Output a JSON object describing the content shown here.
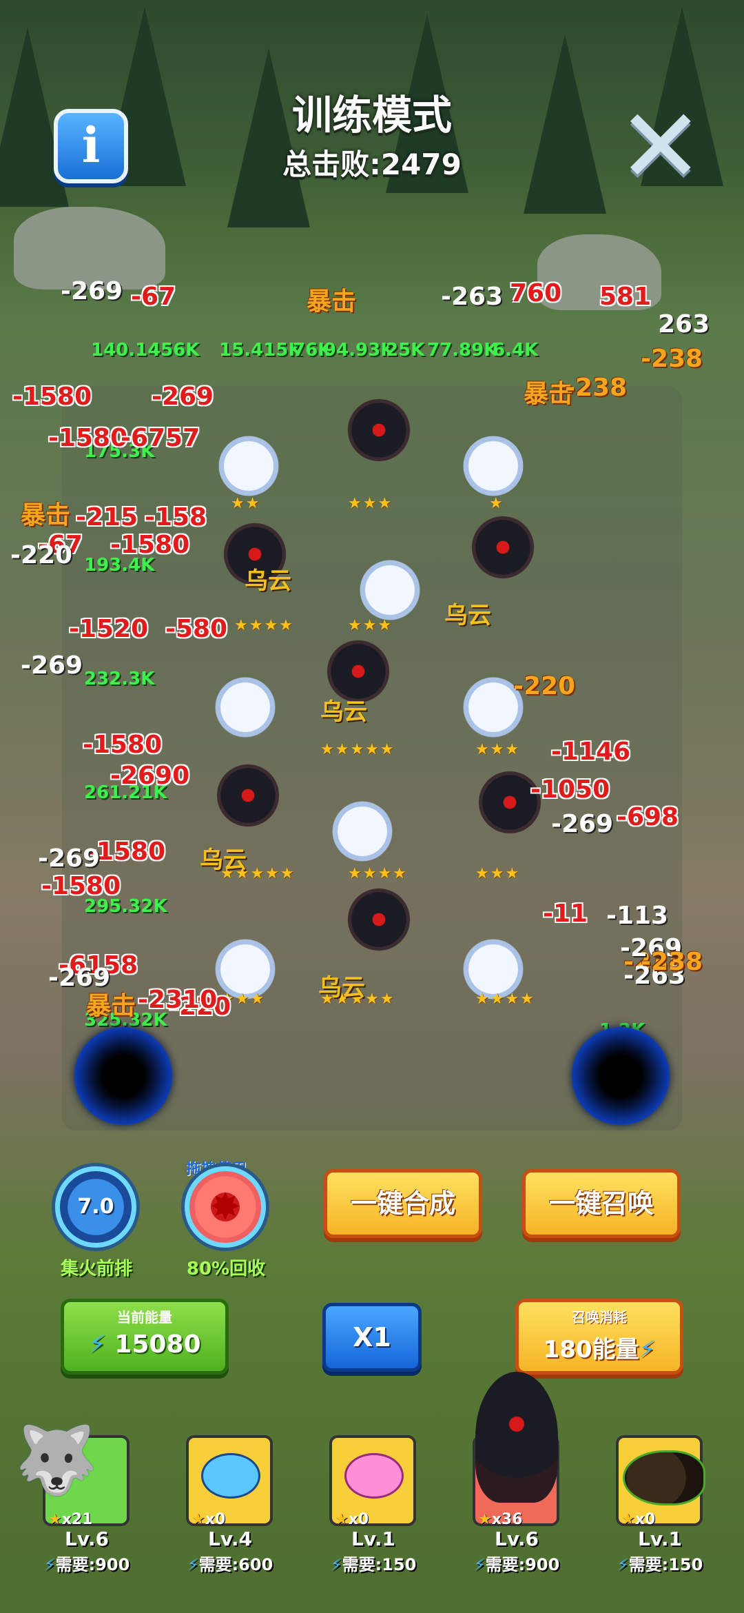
{
  "header": {
    "title": "训练模式",
    "subtitle": "总击败:2479",
    "info_icon": "info-icon",
    "close_icon": "close-icon"
  },
  "battle": {
    "unit_tags": [
      "乌云",
      "乌云",
      "乌云",
      "乌云",
      "乌云"
    ],
    "star_rows": [
      "★★",
      "★★★",
      "★",
      "★★★★",
      "★★★",
      "★★★★★",
      "★★★",
      "★★★★★",
      "★★★★",
      "★★★",
      "★★★",
      "★★★★★",
      "★★★★"
    ],
    "floating_numbers": [
      "-269",
      "-67",
      "暴击",
      "-263",
      "760",
      "581",
      "-238",
      "263",
      "-1580",
      "-269",
      "-1580",
      "-6757",
      "暴击",
      "-215",
      "-158",
      "-67",
      "-1580",
      "-220",
      "-1520",
      "-580",
      "-269",
      "-2690",
      "-1580",
      "暴击",
      "-238",
      "-1146",
      "-698",
      "-1580",
      "-1580",
      "-269",
      "-6158",
      "-220",
      "-269",
      "-1050",
      "-220",
      "-269",
      "暴击",
      "-2310",
      "-11",
      "-238",
      "-269",
      "-263",
      "-113",
      "-238"
    ],
    "hp_labels": [
      "140.14",
      "456K",
      "15.415K",
      "76K",
      "94.93K",
      "25K",
      "77.89K",
      "6.4K",
      "175.3K",
      "193.4K",
      "232.3K",
      "261.21K",
      "295.32K",
      "325.32K",
      "1.2K"
    ]
  },
  "skills": {
    "drag_hint": "拖拽使用",
    "focus_fire": {
      "value": "7.0",
      "label": "集火前排"
    },
    "recycle": {
      "label": "80%回收"
    }
  },
  "actions": {
    "merge_all": "一键合成",
    "summon_all": "一键召唤"
  },
  "energy": {
    "current_label": "当前能量",
    "current_value": "15080",
    "speed": "X1",
    "summon_label": "召唤消耗",
    "summon_value": "180能量"
  },
  "cards": [
    {
      "count": "x21",
      "level": "Lv.6",
      "cost": "需要:900",
      "color": "#6fd84a"
    },
    {
      "count": "x0",
      "level": "Lv.4",
      "cost": "需要:600",
      "color": "#f8cf3a"
    },
    {
      "count": "x0",
      "level": "Lv.1",
      "cost": "需要:150",
      "color": "#f8cf3a"
    },
    {
      "count": "x36",
      "level": "Lv.6",
      "cost": "需要:900",
      "color": "#f06a5a"
    },
    {
      "count": "x0",
      "level": "Lv.1",
      "cost": "需要:150",
      "color": "#f8cf3a"
    }
  ],
  "colors": {
    "damage": "#e01b1b",
    "crit": "#f6a51f",
    "hp": "#3df04b"
  }
}
